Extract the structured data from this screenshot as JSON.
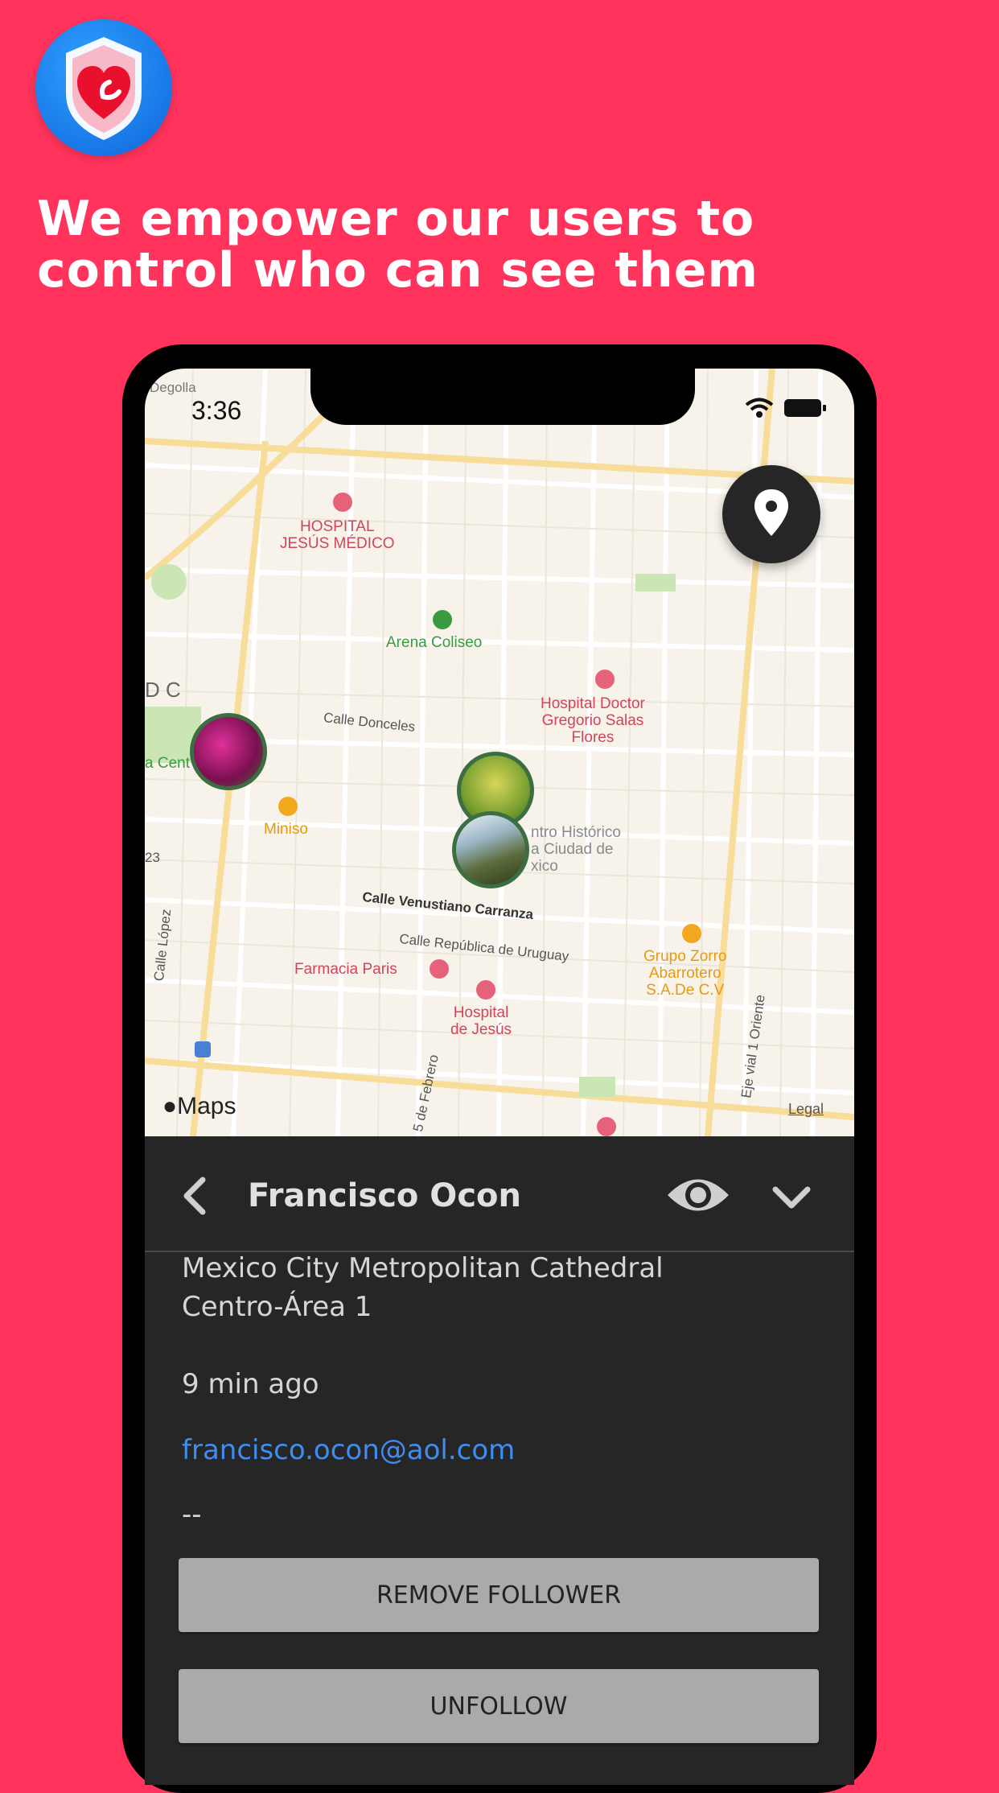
{
  "promo": {
    "headline_line1": "We empower our users to",
    "headline_line2": "control who can see them",
    "brand_color": "#ff335c"
  },
  "status_bar": {
    "time": "3:36"
  },
  "map": {
    "labels": {
      "hospital_jesus_medico_1": "HOSPITAL",
      "hospital_jesus_medico_2": "JESÚS MÉDICO",
      "arena_coliseo": "Arena Coliseo",
      "hospital_doctor_1": "Hospital Doctor",
      "hospital_doctor_2": "Gregorio Salas",
      "hospital_doctor_3": "Flores",
      "calle_donceles": "Calle Donceles",
      "miniso": "Miniso",
      "centro_historico_1": "ntro Histórico",
      "centro_historico_2": "a Ciudad de",
      "centro_historico_3": "xico",
      "calle_venustiano": "Calle Venustiano Carranza",
      "calle_republica": "Calle República de Uruguay",
      "grupo_zorro_1": "Grupo Zorro",
      "grupo_zorro_2": "Abarrotero",
      "grupo_zorro_3": "S.A.De C.V",
      "farmacia_paris": "Farmacia Paris",
      "hospital_jesus_1": "Hospital",
      "hospital_jesus_2": "de Jesús",
      "calle_lopez": "Calle López",
      "eje_vial": "Eje vial 1 Oriente",
      "de_febrero": "5 de Febrero",
      "degolla": "Degolla",
      "dc": "D C",
      "a_cent": "a Cent",
      "num_23": "23"
    },
    "maps_brand": "Maps",
    "legal": "Legal"
  },
  "profile": {
    "name": "Francisco Ocon",
    "place_line1": "Mexico City Metropolitan Cathedral",
    "place_line2": "Centro-Área 1",
    "time_ago": "9 min ago",
    "email": "francisco.ocon@aol.com",
    "extra": "--"
  },
  "actions": {
    "remove_follower": "REMOVE FOLLOWER",
    "unfollow": "UNFOLLOW"
  }
}
